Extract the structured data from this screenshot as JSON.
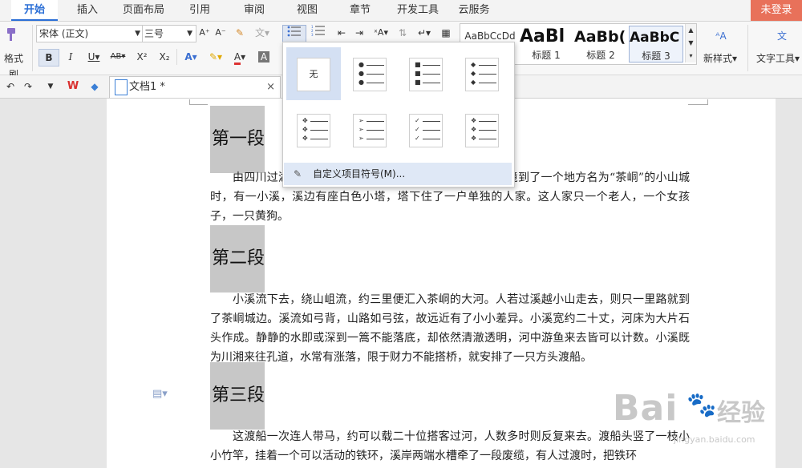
{
  "menu": {
    "tabs": [
      {
        "label": "开始"
      },
      {
        "label": "插入"
      },
      {
        "label": "页面布局"
      },
      {
        "label": "引用"
      },
      {
        "label": "审阅"
      },
      {
        "label": "视图"
      },
      {
        "label": "章节"
      },
      {
        "label": "开发工具"
      },
      {
        "label": "云服务"
      }
    ],
    "login": "未登录"
  },
  "ribbon": {
    "format_painter": "格式刷",
    "font_name": "宋体 (正文)",
    "font_size": "三号",
    "bold": "B",
    "italic": "I",
    "underline": "U",
    "strike": "AB",
    "superscript": "X²",
    "subscript": "X₂",
    "styles": [
      {
        "preview": "AaBbCcDd",
        "label": ""
      },
      {
        "preview": "AaBl",
        "label": "标题 1"
      },
      {
        "preview": "AaBb(",
        "label": "标题 2"
      },
      {
        "preview": "AaBbC",
        "label": "标题 3"
      }
    ],
    "new_style": "新样式",
    "text_tools": "文字工具"
  },
  "qat": {
    "doc_name": "文档1 *"
  },
  "dropdown": {
    "none_label": "无",
    "custom_label": "自定义项目符号(M)..."
  },
  "document": {
    "h1": "第一段",
    "p1": "由四川过湖南去，靠东有一条官路。这官路将近湘西边境到了一个地方名为“茶峒”的小山城时，有一小溪，溪边有座白色小塔，塔下住了一户单独的人家。这人家只一个老人，一个女孩子，一只黄狗。",
    "h2": "第二段",
    "p2": "小溪流下去，绕山岨流，约三里便汇入茶峒的大河。人若过溪越小山走去，则只一里路就到了茶峒城边。溪流如弓背，山路如弓弦，故远近有了小小差异。小溪宽约二十丈，河床为大片石头作成。静静的水即或深到一篙不能落底，却依然清澈透明，河中游鱼来去皆可以计数。小溪既为川湘来往孔道，水常有涨落，限于财力不能搭桥，就安排了一只方头渡船。",
    "h3": "第三段",
    "p3": "这渡船一次连人带马，约可以载二十位搭客过河，人数多时则反复来去。渡船头竖了一枝小小竹竿，挂着一个可以活动的铁环，溪岸两端水槽牵了一段废缆，有人过渡时，把铁环"
  },
  "watermark": {
    "brand": "Bai",
    "suffix": "经验",
    "url": "jingyan.baidu.com"
  },
  "colors": {
    "accent": "#2b6fd6",
    "login_bg": "#e8715a",
    "heading_bg": "#c7c7c7",
    "dropdown_hover": "#dfe8f6"
  }
}
